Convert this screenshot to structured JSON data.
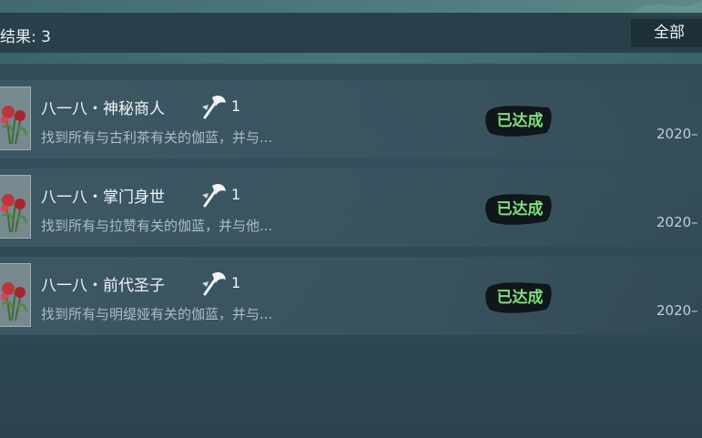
{
  "header": {
    "result_label": "结果: 3",
    "filter_label": "全部"
  },
  "colors": {
    "accent_green": "#7fe07a",
    "stamp_black": "#101619"
  },
  "rows": [
    {
      "title": "八一八・神秘商人",
      "icon": "axe-icon",
      "count": "1",
      "description": "找到所有与古利茶有关的伽蓝，并与...",
      "status": "已达成",
      "date": "2020–"
    },
    {
      "title": "八一八・掌门身世",
      "icon": "axe-icon",
      "count": "1",
      "description": "找到所有与拉赞有关的伽蓝，并与他...",
      "status": "已达成",
      "date": "2020–"
    },
    {
      "title": "八一八・前代圣子",
      "icon": "axe-icon",
      "count": "1",
      "description": "找到所有与明缇娅有关的伽蓝，并与...",
      "status": "已达成",
      "date": "2020–"
    }
  ]
}
